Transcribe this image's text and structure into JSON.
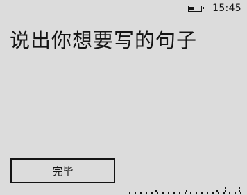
{
  "status_bar": {
    "time": "15:45",
    "battery_icon": "battery-icon",
    "battery_level": 0.4
  },
  "prompt": {
    "text": "说出你想要写的句子"
  },
  "done_button": {
    "label": "完毕"
  },
  "progress_indicator": {
    "icon": "listening-dots-indicator"
  }
}
